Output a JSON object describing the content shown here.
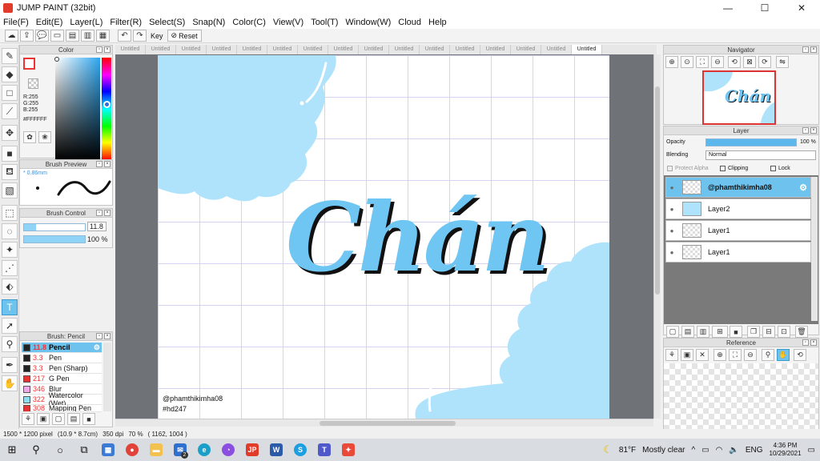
{
  "window": {
    "title": "JUMP PAINT (32bit)",
    "minimize": "—",
    "maximize": "☐",
    "close": "✕"
  },
  "menu": [
    "File(F)",
    "Edit(E)",
    "Layer(L)",
    "Filter(R)",
    "Select(S)",
    "Snap(N)",
    "Color(C)",
    "View(V)",
    "Tool(T)",
    "Window(W)",
    "Cloud",
    "Help"
  ],
  "toolbar": {
    "key_label": "Key",
    "reset_label": "Reset"
  },
  "color_panel": {
    "title": "Color",
    "r": "R:255",
    "g": "G:255",
    "b": "B:255",
    "hex": "#FFFFFF",
    "accent": "#2ea7f0"
  },
  "brush_preview": {
    "title": "Brush Preview",
    "size": "* 0.86mm"
  },
  "brush_control": {
    "title": "Brush Control",
    "size_value": "11.8",
    "opacity_value": "100 %",
    "size_fraction": 0.2,
    "opacity_fraction": 1.0
  },
  "brush_list": {
    "title": "Brush: Pencil",
    "items": [
      {
        "size": "11.8",
        "name": "Pencil",
        "color": "#222222"
      },
      {
        "size": "3.3",
        "name": "Pen",
        "color": "#222222"
      },
      {
        "size": "3.3",
        "name": "Pen (Sharp)",
        "color": "#222222"
      },
      {
        "size": "217",
        "name": "G Pen",
        "color": "#e33333"
      },
      {
        "size": "346",
        "name": "Blur",
        "color": "#f0a8e8"
      },
      {
        "size": "322",
        "name": "Watercolor (Wet)",
        "color": "#8fdcf0"
      },
      {
        "size": "308",
        "name": "Mapping Pen",
        "color": "#e33333"
      }
    ]
  },
  "tabs": [
    "Untitled",
    "Untitled",
    "Untitled",
    "Untitled",
    "Untitled",
    "Untitled",
    "Untitled",
    "Untitled",
    "Untitled",
    "Untitled",
    "Untitled",
    "Untitled",
    "Untitled",
    "Untitled",
    "Untitled",
    "Untitled"
  ],
  "canvas": {
    "lettering": "Chán",
    "credit_line1": "@phamthikimha08",
    "credit_line2": "#hd247",
    "cloud_color": "#aee3fb"
  },
  "status": {
    "size": "1500 * 1200 pixel",
    "physical": "(10.9 * 8.7cm)",
    "dpi": "350 dpi",
    "zoom": "70 %",
    "coords": "( 1162, 1004 )"
  },
  "navigator": {
    "title": "Navigator",
    "thumb_text": "Chán"
  },
  "layer_panel": {
    "title": "Layer",
    "opacity_label": "Opacity",
    "opacity_value": "100 %",
    "blending_label": "Blending",
    "blending_value": "Normal",
    "protect_alpha": "Protect Alpha",
    "clipping": "Clipping",
    "lock": "Lock",
    "layers": [
      {
        "name": "@phamthikimha08"
      },
      {
        "name": "Layer2"
      },
      {
        "name": "Layer1"
      },
      {
        "name": "Layer1"
      }
    ]
  },
  "reference": {
    "title": "Reference"
  },
  "taskbar": {
    "weather_temp": "81°F",
    "weather_text": "Mostly clear",
    "lang": "ENG",
    "time": "4:36 PM",
    "date": "10/29/2021",
    "mail_badge": "2"
  }
}
